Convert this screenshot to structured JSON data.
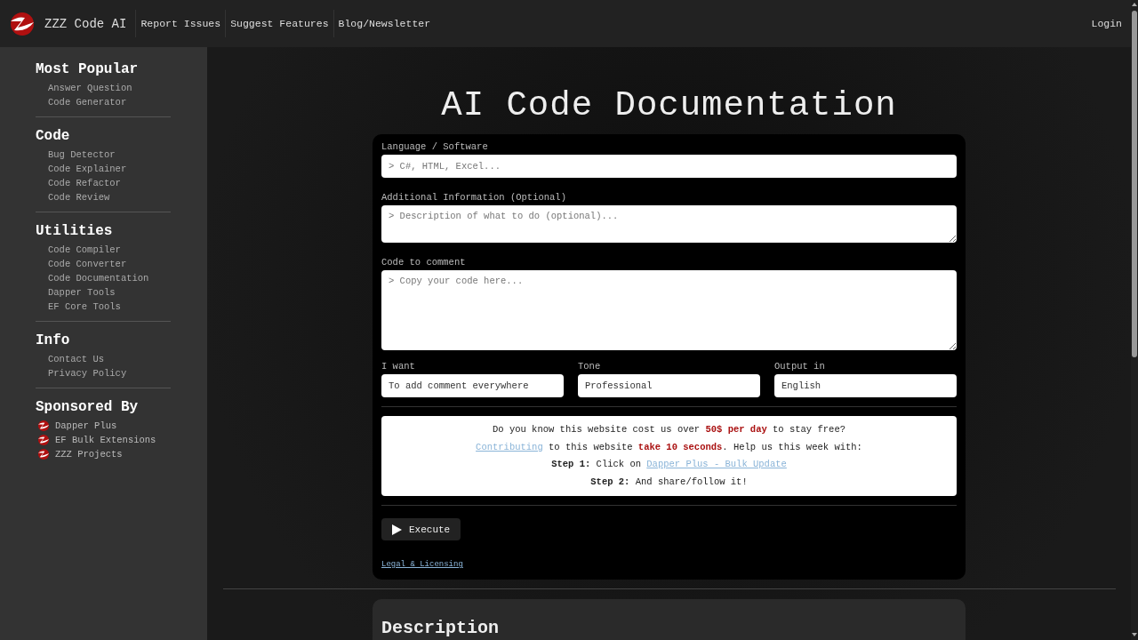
{
  "header": {
    "brand": "ZZZ Code AI",
    "nav": [
      "Report Issues",
      "Suggest Features",
      "Blog/Newsletter"
    ],
    "login": "Login"
  },
  "sidebar": {
    "sections": [
      {
        "title": "Most Popular",
        "kind": "links",
        "items": [
          "Answer Question",
          "Code Generator"
        ]
      },
      {
        "title": "Code",
        "kind": "links",
        "items": [
          "Bug Detector",
          "Code Explainer",
          "Code Refactor",
          "Code Review"
        ]
      },
      {
        "title": "Utilities",
        "kind": "links",
        "items": [
          "Code Compiler",
          "Code Converter",
          "Code Documentation",
          "Dapper Tools",
          "EF Core Tools"
        ]
      },
      {
        "title": "Info",
        "kind": "links",
        "items": [
          "Contact Us",
          "Privacy Policy"
        ]
      },
      {
        "title": "Sponsored By",
        "kind": "sponsors",
        "items": [
          "Dapper Plus",
          "EF Bulk Extensions",
          "ZZZ Projects"
        ]
      }
    ]
  },
  "page_title": "AI Code Documentation",
  "form": {
    "fields": [
      {
        "label": "Language / Software",
        "kind": "input",
        "placeholder": "> C#, HTML, Excel..."
      },
      {
        "label": "Additional Information (Optional)",
        "kind": "textarea-small",
        "placeholder": "> Description of what to do (optional)..."
      },
      {
        "label": "Code to comment",
        "kind": "textarea-large",
        "placeholder": "> Copy your code here..."
      }
    ],
    "selects": [
      {
        "label": "I want",
        "value": "To add comment everywhere"
      },
      {
        "label": "Tone",
        "value": "Professional"
      },
      {
        "label": "Output in",
        "value": "English"
      }
    ],
    "notice": [
      [
        {
          "kind": "plain",
          "text": "Do you know this website cost us over "
        },
        {
          "kind": "highlight",
          "text": "50$ per day"
        },
        {
          "kind": "plain",
          "text": " to stay free?"
        }
      ],
      [
        {
          "kind": "link",
          "text": "Contributing"
        },
        {
          "kind": "plain",
          "text": " to this website "
        },
        {
          "kind": "highlight",
          "text": "take 10 seconds"
        },
        {
          "kind": "plain",
          "text": ". Help us this week with:"
        }
      ],
      [
        {
          "kind": "strong",
          "text": "Step 1:"
        },
        {
          "kind": "plain",
          "text": " Click on "
        },
        {
          "kind": "link",
          "text": "Dapper Plus - Bulk Update"
        }
      ],
      [
        {
          "kind": "strong",
          "text": "Step 2:"
        },
        {
          "kind": "plain",
          "text": " And share/follow it!"
        }
      ]
    ],
    "execute": "Execute",
    "legal": "Legal & Licensing"
  },
  "description": {
    "title": "Description"
  }
}
